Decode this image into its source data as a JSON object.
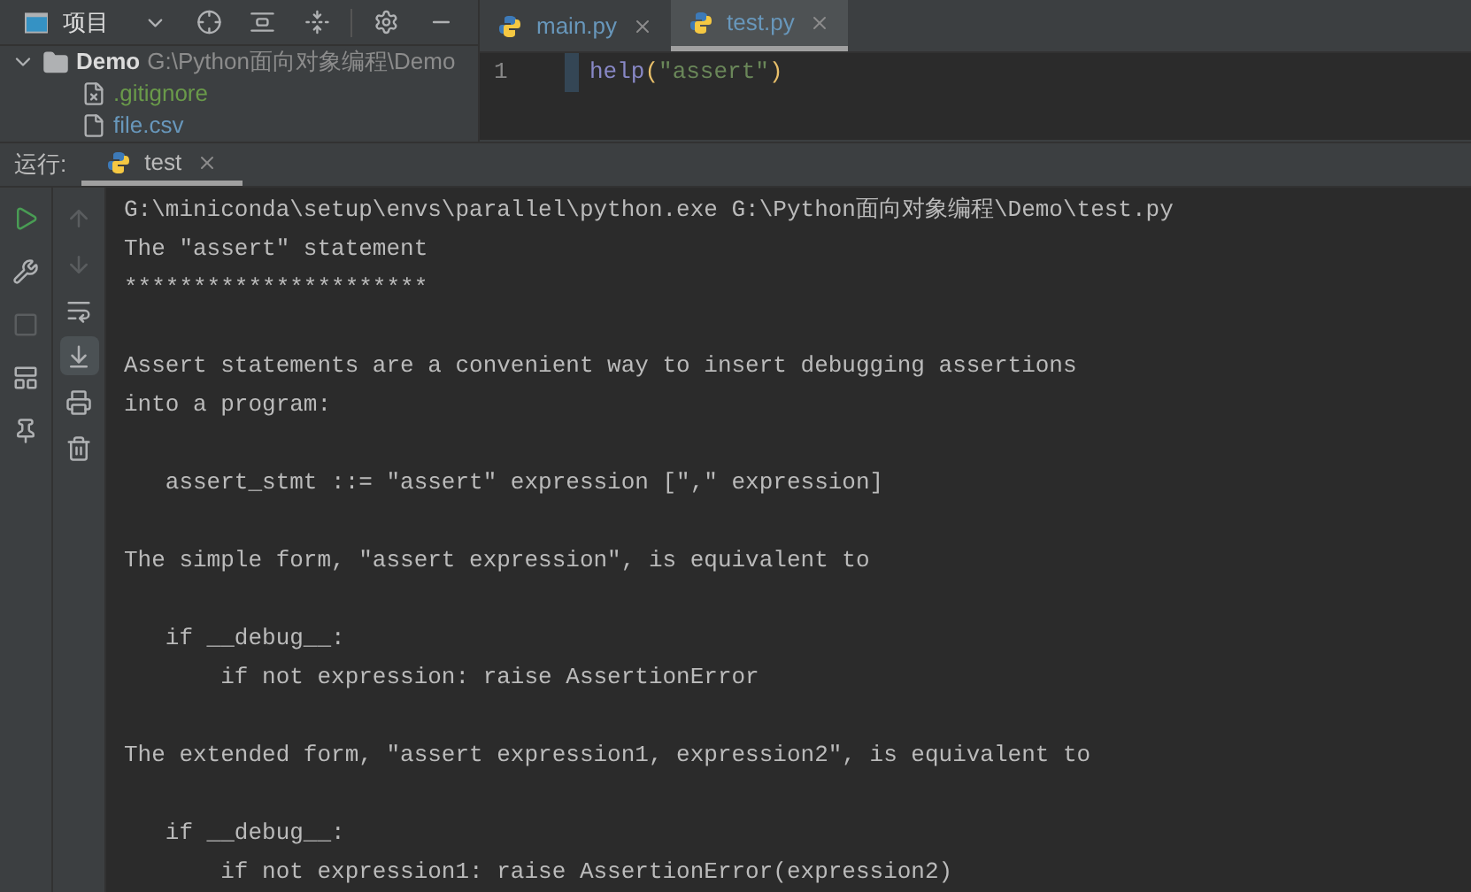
{
  "project_panel": {
    "title": "项目",
    "tree": [
      {
        "name": "Demo",
        "path": "G:\\Python面向对象编程\\Demo",
        "expanded": true,
        "children": [
          {
            "name": ".gitignore",
            "kind": "ignored"
          },
          {
            "name": "file.csv",
            "kind": "file"
          }
        ]
      }
    ]
  },
  "editor": {
    "tabs": [
      {
        "label": "main.py",
        "selected": false
      },
      {
        "label": "test.py",
        "selected": true
      }
    ],
    "lines": [
      {
        "number": "1",
        "code": [
          {
            "kind": "func",
            "text": "help"
          },
          {
            "kind": "paren",
            "text": "("
          },
          {
            "kind": "string",
            "text": "\"assert\""
          },
          {
            "kind": "paren",
            "text": ")"
          }
        ]
      }
    ]
  },
  "run_panel": {
    "label": "运行:",
    "tabs": [
      {
        "label": "test",
        "selected": true
      }
    ],
    "console": [
      {
        "kind": "text",
        "text": "G:\\miniconda\\setup\\envs\\parallel\\python.exe G:\\Python面向对象编程\\Demo\\test.py"
      },
      {
        "kind": "text",
        "text": "The \"assert\" statement"
      },
      {
        "kind": "text",
        "text": "**********************"
      },
      {
        "kind": "blank"
      },
      {
        "kind": "text",
        "text": "Assert statements are a convenient way to insert debugging assertions"
      },
      {
        "kind": "text",
        "text": "into a program:"
      },
      {
        "kind": "blank"
      },
      {
        "kind": "text",
        "text": "   assert_stmt ::= \"assert\" expression [\",\" expression]"
      },
      {
        "kind": "blank"
      },
      {
        "kind": "text",
        "text": "The simple form, \"assert expression\", is equivalent to"
      },
      {
        "kind": "blank"
      },
      {
        "kind": "text",
        "text": "   if __debug__:"
      },
      {
        "kind": "text",
        "text": "       if not expression: raise AssertionError"
      },
      {
        "kind": "blank"
      },
      {
        "kind": "text",
        "text": "The extended form, \"assert expression1, expression2\", is equivalent to"
      },
      {
        "kind": "blank"
      },
      {
        "kind": "text",
        "text": "   if __debug__:"
      },
      {
        "kind": "text",
        "text": "       if not expression1: raise AssertionError(expression2)"
      }
    ]
  }
}
